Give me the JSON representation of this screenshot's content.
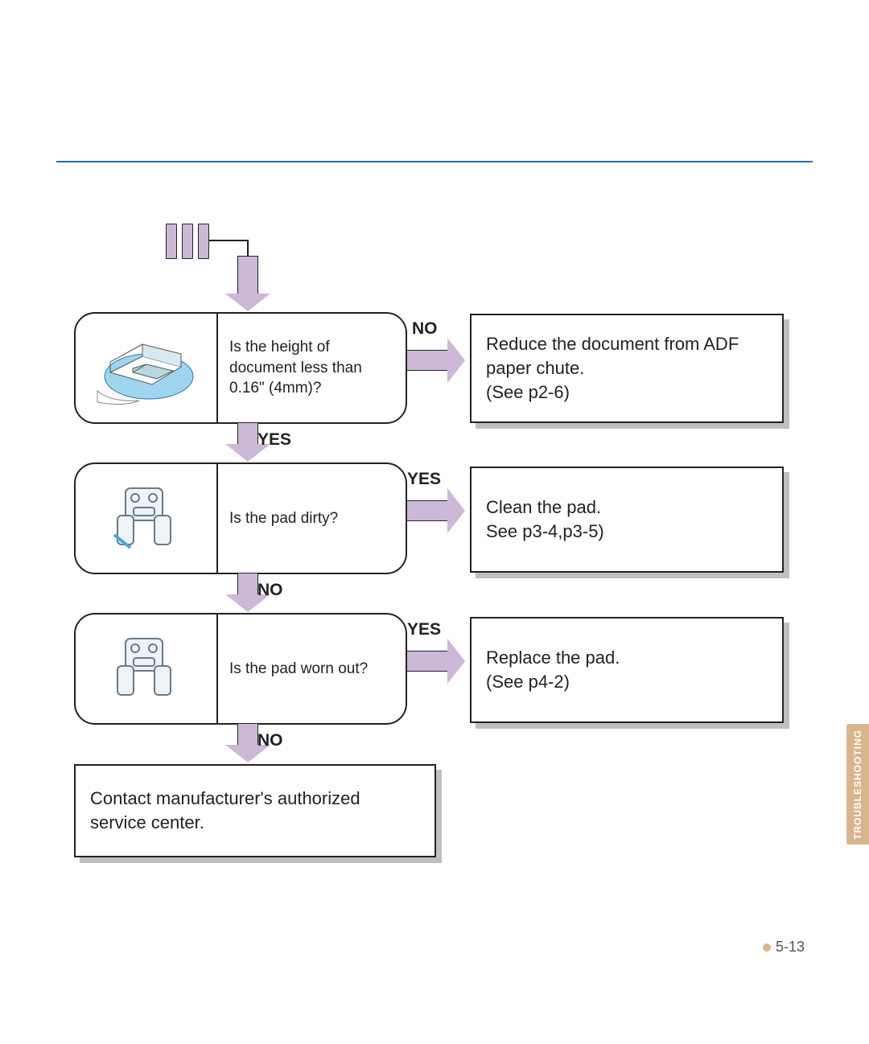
{
  "header_rule_color": "#1b6fb6",
  "side_tab": "TROUBLESHOOTING",
  "page_number": "5-13",
  "flow": {
    "steps": [
      {
        "question": "Is the height of document less than 0.16\" (4mm)?",
        "branch_right": "NO",
        "branch_down": "YES",
        "action": "Reduce the document from ADF paper chute.\n(See p2-6)"
      },
      {
        "question": "Is the pad dirty?",
        "branch_right": "YES",
        "branch_down": "NO",
        "action": "Clean the pad.\nSee p3-4,p3-5)"
      },
      {
        "question": "Is the pad worn out?",
        "branch_right": "YES",
        "branch_down": "NO",
        "action": "Replace the pad.\n(See p4-2)"
      }
    ],
    "final": "Contact manufacturer's authorized service center."
  }
}
